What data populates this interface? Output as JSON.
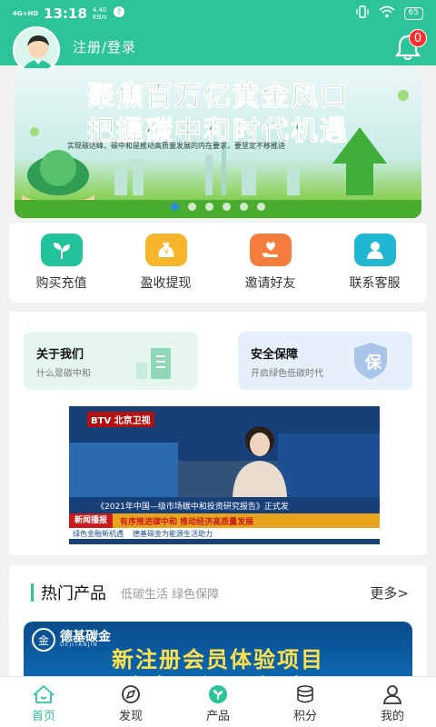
{
  "status_bar": {
    "network": "4G+HD",
    "time": "13:18",
    "speed_value": "4.40",
    "speed_unit": "KB/s",
    "battery": "65"
  },
  "header": {
    "login_text": "注册/登录",
    "notification_count": "0"
  },
  "banner": {
    "title_line1": "聚焦百万亿黄金风口",
    "title_line2": "把握碳中和时代机遇",
    "subtitle": "实现碳达峰、碳中和是推动高质量发展的内在要求，要坚定不移推进",
    "page_count": 6,
    "active_page": 0
  },
  "quick_actions": [
    {
      "label": "购买充值",
      "icon": "seedling-icon",
      "color": "#22c39a"
    },
    {
      "label": "盈收提现",
      "icon": "money-bag-icon",
      "color": "#f6b52a"
    },
    {
      "label": "邀请好友",
      "icon": "heart-hand-icon",
      "color": "#f47c3c"
    },
    {
      "label": "联系客服",
      "icon": "person-icon",
      "color": "#1fb7d1"
    }
  ],
  "info_cards": [
    {
      "title": "关于我们",
      "subtitle": "什么是碳中和",
      "bg": "#e5f6ef"
    },
    {
      "title": "安全保障",
      "subtitle": "开启绿色低碳时代",
      "bg": "#e6f0fb",
      "seal": "保"
    }
  ],
  "video": {
    "logo": "BTV 北京卫视",
    "caption": "《2021年中国—级市场碳中和投资研究报告》正式发",
    "ticker_tag": "新闻播报",
    "ticker_text": "有序推进碳中和 推动经济高质量发展",
    "ticker2_left": "绿色金融新机遇",
    "ticker2_right": "德基碳金为能源生活助力"
  },
  "hot_products": {
    "title": "热门产品",
    "tags": "低碳生活 绿色保障",
    "more": "更多>",
    "card": {
      "brand": "德基碳金",
      "brand_en": "DEJITANJIN",
      "line1": "新注册会员体验项目",
      "line2": "轻松入门 了解碳"
    }
  },
  "bottom_nav": [
    {
      "label": "首页",
      "icon": "home-icon",
      "active": true
    },
    {
      "label": "发现",
      "icon": "compass-icon",
      "active": false
    },
    {
      "label": "产品",
      "icon": "leaf-icon",
      "active": false
    },
    {
      "label": "积分",
      "icon": "coins-icon",
      "active": false
    },
    {
      "label": "我的",
      "icon": "user-icon",
      "active": false
    }
  ],
  "colors": {
    "brand": "#2ec49a",
    "badge": "#ff2d2d",
    "active_dot": "#2a8bd8"
  }
}
